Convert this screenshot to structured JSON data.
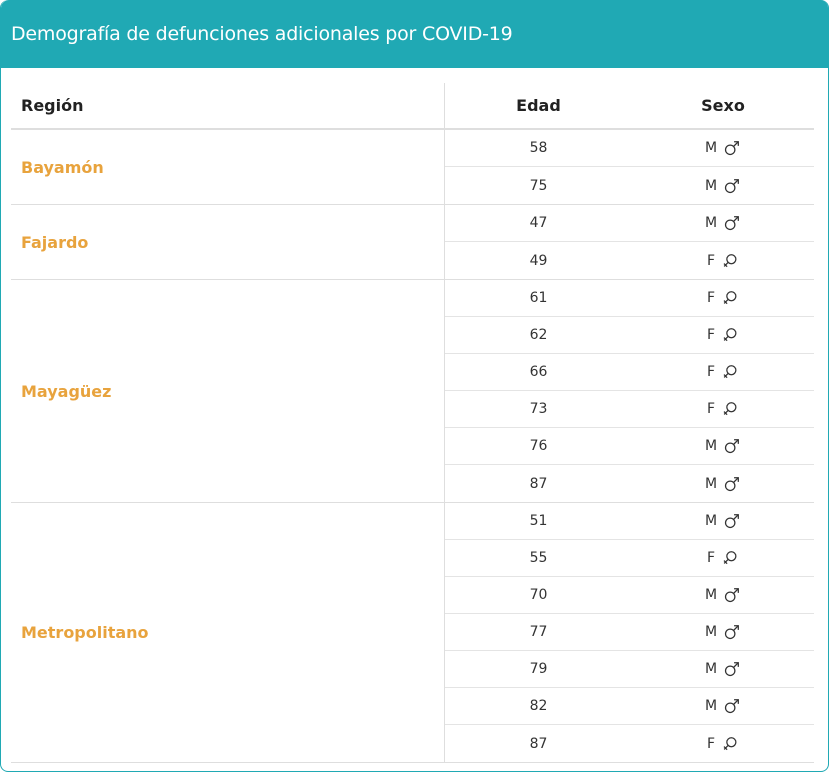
{
  "header": {
    "title": "Demografía de defunciones adicionales por COVID-19"
  },
  "table": {
    "columns": {
      "region": "Región",
      "edad": "Edad",
      "sexo": "Sexo"
    },
    "groups": [
      {
        "region": "Bayamón",
        "rows": [
          {
            "edad": "58",
            "sexo": "M",
            "icon": "male-icon"
          },
          {
            "edad": "75",
            "sexo": "M",
            "icon": "male-icon"
          }
        ]
      },
      {
        "region": "Fajardo",
        "rows": [
          {
            "edad": "47",
            "sexo": "M",
            "icon": "male-icon"
          },
          {
            "edad": "49",
            "sexo": "F",
            "icon": "female-icon"
          }
        ]
      },
      {
        "region": "Mayagüez",
        "rows": [
          {
            "edad": "61",
            "sexo": "F",
            "icon": "female-icon"
          },
          {
            "edad": "62",
            "sexo": "F",
            "icon": "female-icon"
          },
          {
            "edad": "66",
            "sexo": "F",
            "icon": "female-icon"
          },
          {
            "edad": "73",
            "sexo": "F",
            "icon": "female-icon"
          },
          {
            "edad": "76",
            "sexo": "M",
            "icon": "male-icon"
          },
          {
            "edad": "87",
            "sexo": "M",
            "icon": "male-icon"
          }
        ]
      },
      {
        "region": "Metropolitano",
        "rows": [
          {
            "edad": "51",
            "sexo": "M",
            "icon": "male-icon"
          },
          {
            "edad": "55",
            "sexo": "F",
            "icon": "female-icon"
          },
          {
            "edad": "70",
            "sexo": "M",
            "icon": "male-icon"
          },
          {
            "edad": "77",
            "sexo": "M",
            "icon": "male-icon"
          },
          {
            "edad": "79",
            "sexo": "M",
            "icon": "male-icon"
          },
          {
            "edad": "82",
            "sexo": "M",
            "icon": "male-icon"
          },
          {
            "edad": "87",
            "sexo": "F",
            "icon": "female-icon"
          }
        ]
      }
    ]
  },
  "colors": {
    "header_bg": "#20a9b4",
    "region_text": "#e8a33d",
    "icon": "#333333"
  }
}
